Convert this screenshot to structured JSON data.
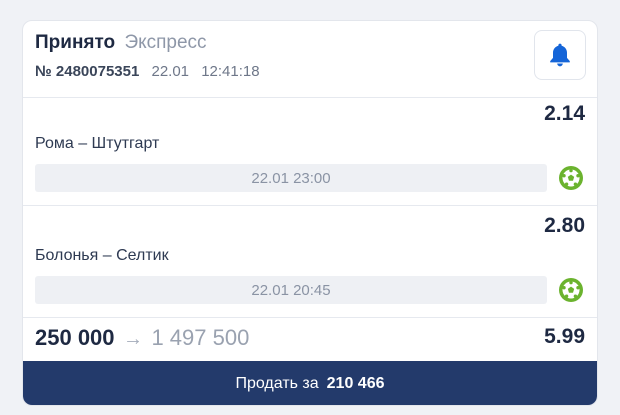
{
  "bet": {
    "status": "Принято",
    "type": "Экспресс",
    "number": "№ 2480075351",
    "date": "22.01",
    "time": "12:41:18"
  },
  "events": [
    {
      "teams": "Рома – Штутгарт",
      "odds": "2.14",
      "start": "22.01 23:00",
      "sport_icon": "football-icon"
    },
    {
      "teams": "Болонья – Селтик",
      "odds": "2.80",
      "start": "22.01 20:45",
      "sport_icon": "football-icon"
    }
  ],
  "summary": {
    "stake": "250 000",
    "arrow": "→",
    "payout": "1 497 500",
    "total_odds": "5.99"
  },
  "sell_button": {
    "label": "Продать за",
    "amount": "210 466"
  },
  "colors": {
    "primary": "#233a6b",
    "bell": "#1565d8",
    "sport_icon": "#6bb32e"
  }
}
